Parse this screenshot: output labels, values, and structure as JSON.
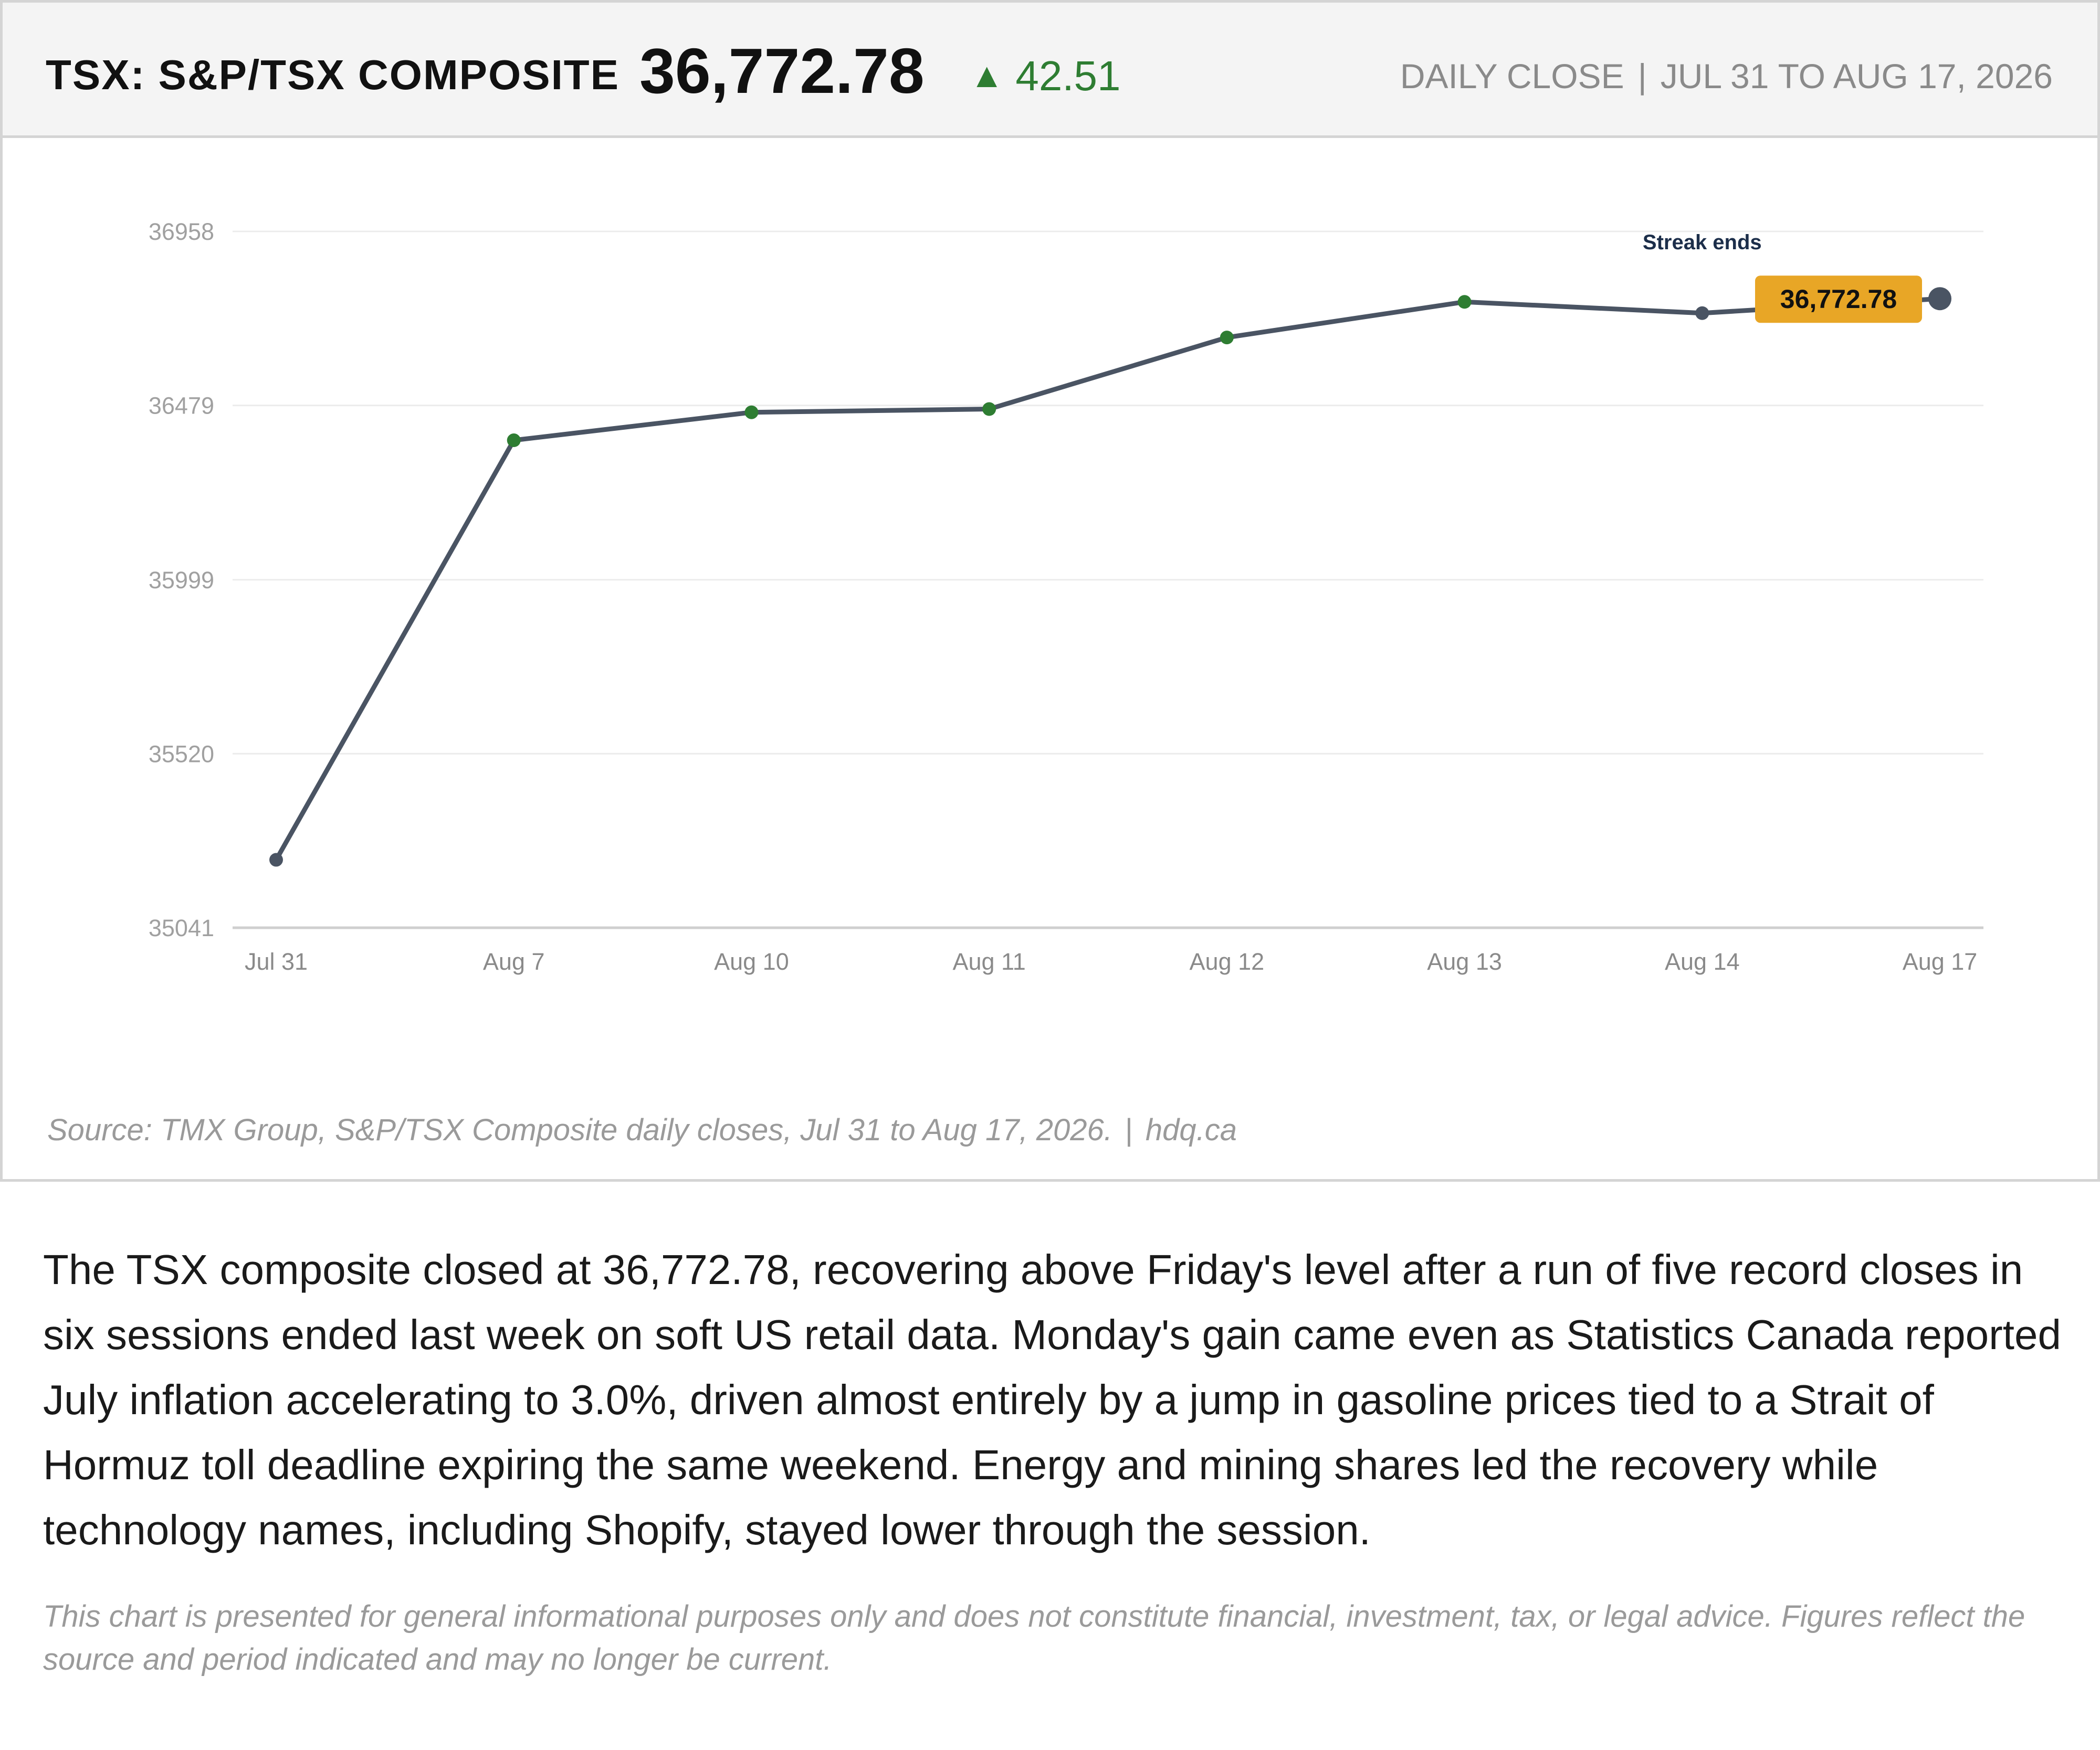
{
  "header": {
    "ticker": "TSX: S&P/TSX COMPOSITE",
    "price": "36,772.78",
    "change_arrow": "▲",
    "change": "42.51",
    "period_label": "DAILY CLOSE",
    "period_separator": "|",
    "period_range": "JUL 31 TO AUG 17, 2026"
  },
  "colors": {
    "line": "#4a5463",
    "up_marker": "#2e7d32",
    "neutral_marker": "#4a5463",
    "callout_bg": "#e8a626",
    "change_up": "#2e7d32"
  },
  "chart_data": {
    "type": "line",
    "categories": [
      "Jul 31",
      "Aug 7",
      "Aug 10",
      "Aug 11",
      "Aug 12",
      "Aug 13",
      "Aug 14",
      "Aug 17"
    ],
    "values": [
      35228,
      36383,
      36460,
      36469,
      36666,
      36764,
      36733,
      36772.78
    ],
    "marker_status": [
      "neutral",
      "up",
      "up",
      "up",
      "up",
      "up",
      "neutral",
      "last"
    ],
    "y_ticks": [
      "36958",
      "36479",
      "35999",
      "35520",
      "35041"
    ],
    "ylim": [
      35041,
      36958
    ],
    "grid": true,
    "annotation": {
      "category": "Aug 14",
      "text": "Streak ends"
    },
    "last_value_label": "36,772.78"
  },
  "footer": {
    "source": "Source: TMX Group, S&P/TSX Composite daily closes, Jul 31 to Aug 17, 2026.",
    "source_separator": "|",
    "source_site": "hdq.ca"
  },
  "article": {
    "body": "The TSX composite closed at 36,772.78, recovering above Friday's level after a run of five record closes in six sessions ended last week on soft US retail data. Monday's gain came even as Statistics Canada reported July inflation accelerating to 3.0%, driven almost entirely by a jump in gasoline prices tied to a Strait of Hormuz toll deadline expiring the same weekend. Energy and mining shares led the recovery while technology names, including Shopify, stayed lower through the session.",
    "disclaimer": "This chart is presented for general informational purposes only and does not constitute financial, investment, tax, or legal advice. Figures reflect the source and period indicated and may no longer be current."
  }
}
